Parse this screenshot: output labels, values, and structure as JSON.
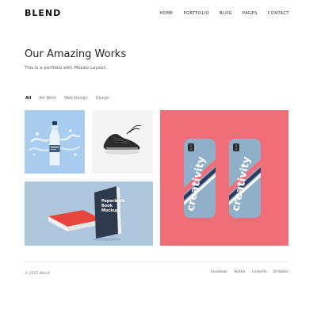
{
  "header": {
    "logo": "BLEND",
    "nav": [
      "HOME",
      "PORTFOLIO",
      "BLOG",
      "PAGES",
      "CONTACT"
    ]
  },
  "hero": {
    "title": "Our Amazing Works",
    "subtitle": "This is a portfolio with Mosaic Layout."
  },
  "filters": [
    "All",
    "Art Work",
    "Web Design",
    "Design"
  ],
  "portfolio": {
    "items": [
      "water-bottle",
      "sneaker",
      "book-mockup",
      "phone-cases"
    ],
    "book_title_lines": [
      "Paperback",
      "Book",
      "Mockup"
    ],
    "phone_text": "creativity"
  },
  "footer": {
    "copyright": "© 2017 Blend",
    "social": [
      "Facebook",
      "Twitter",
      "LinkedIn",
      "Dribbble"
    ]
  },
  "colors": {
    "accent_pink": "#ef6e77",
    "sky_blue": "#a8cdee",
    "phone_blue": "#8fb0c8"
  }
}
